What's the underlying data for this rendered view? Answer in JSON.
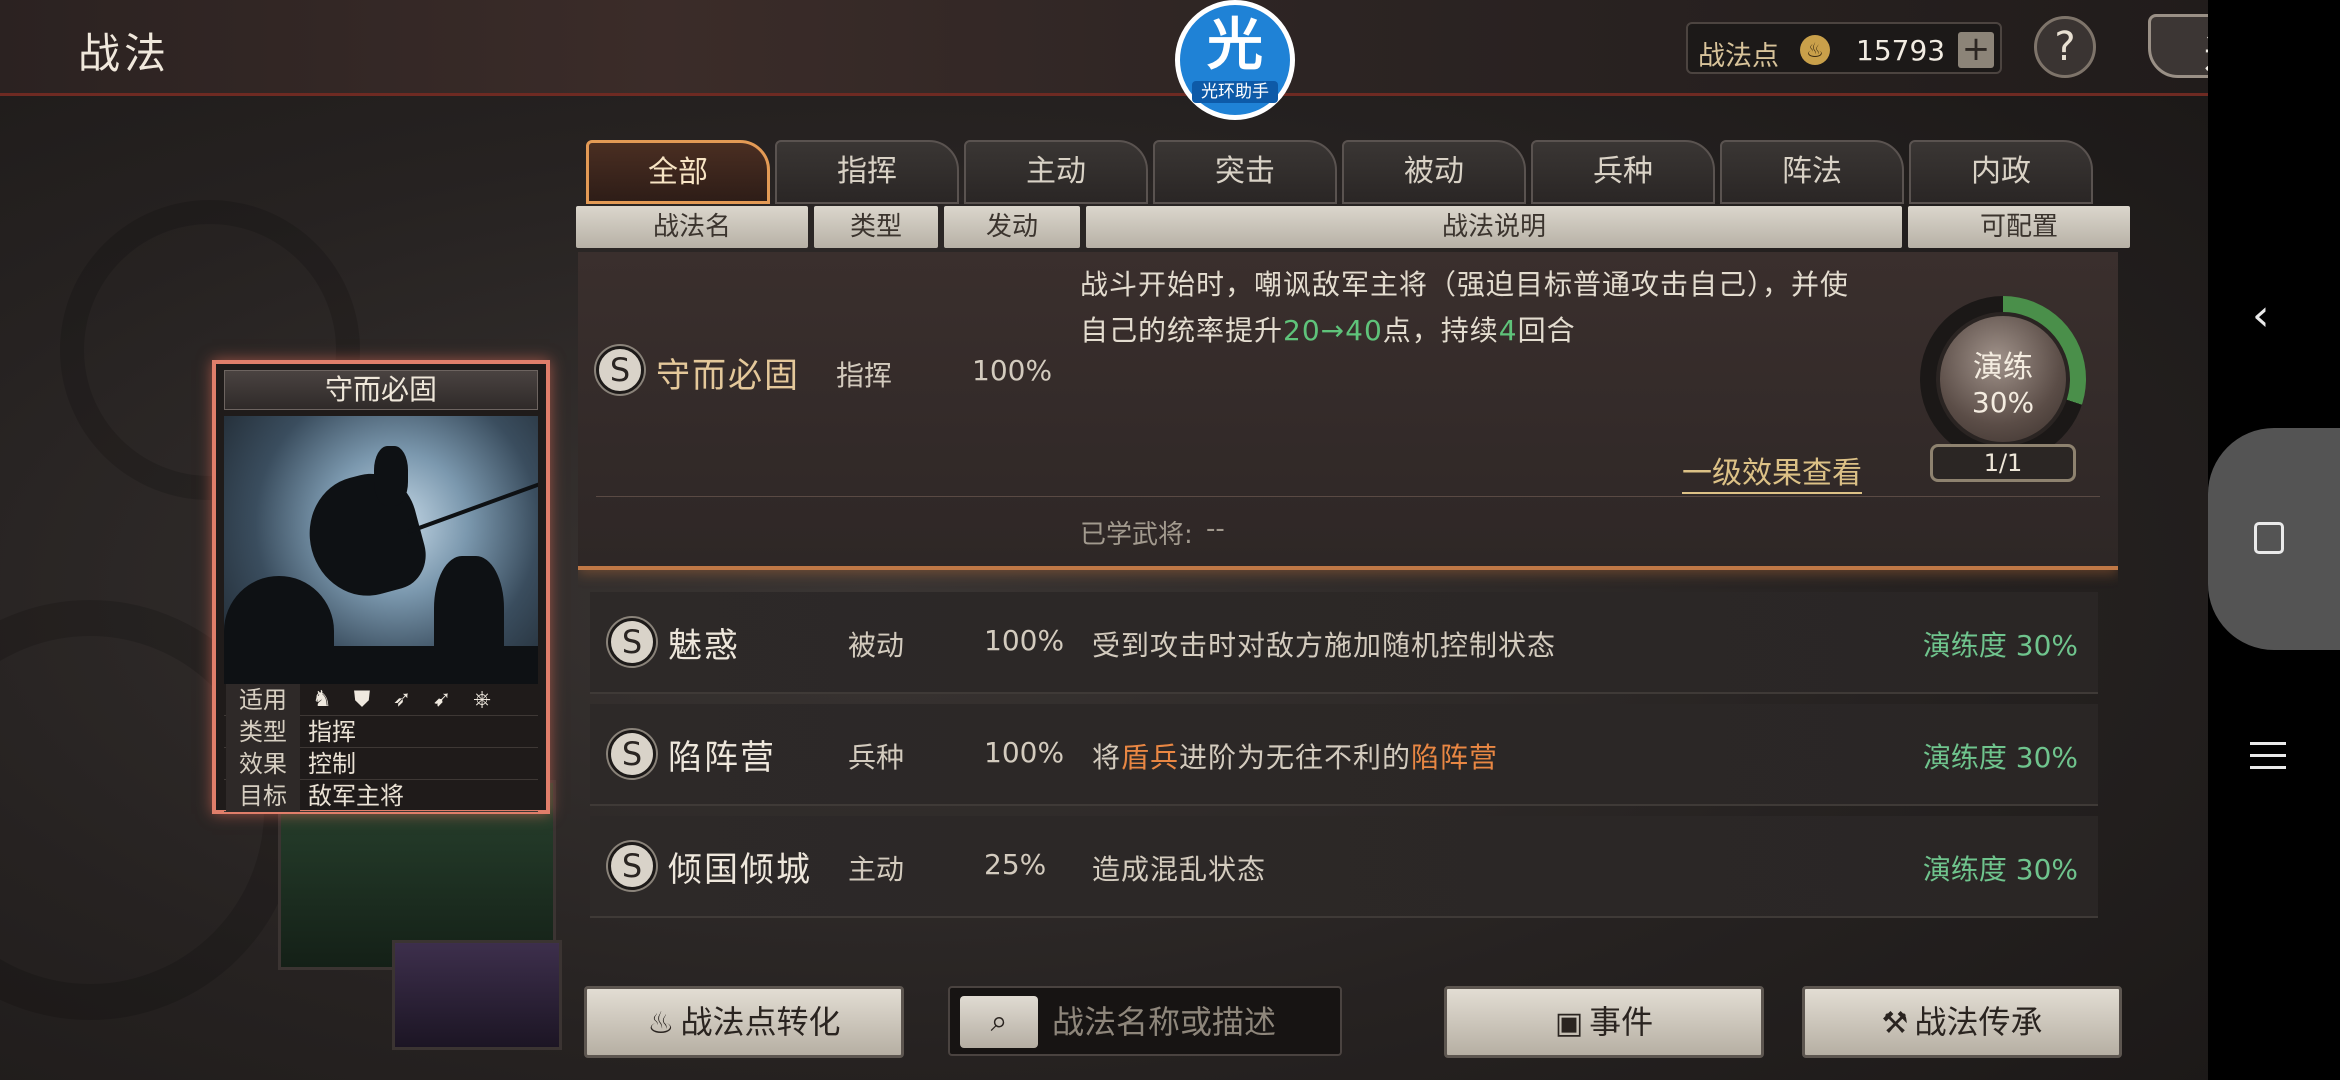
{
  "header": {
    "title": "战法",
    "logo_glyph": "光",
    "logo_text": "光环助手",
    "points_label": "战法点",
    "points_value": "15793",
    "plus": "+",
    "help": "?",
    "back": "返回"
  },
  "tabs": [
    "全部",
    "指挥",
    "主动",
    "突击",
    "被动",
    "兵种",
    "阵法",
    "内政"
  ],
  "active_tab": "全部",
  "columns": {
    "name": "战法名",
    "type": "类型",
    "trigger": "发动",
    "desc": "战法说明",
    "config": "可配置"
  },
  "expanded": {
    "grade": "S",
    "name": "守而必固",
    "type": "指挥",
    "rate": "100%",
    "desc_a": "战斗开始时，嘲讽敌军主将（强迫目标普通攻击自己），并使自己的统率提升",
    "desc_from": "20",
    "desc_arrow": "→",
    "desc_to": "40",
    "desc_b": "点，持续",
    "desc_turns": "4",
    "desc_c": "回合",
    "level_link": "一级效果查看",
    "learned_label": "已学武将:",
    "learned_value": "--",
    "drill_label": "演练",
    "drill_pct": "30%",
    "drill_progress": 0.3,
    "drill_count": "1/1"
  },
  "rows": [
    {
      "grade": "S",
      "name": "魅惑",
      "type": "被动",
      "rate": "100%",
      "desc": [
        {
          "t": "受到攻击时对敌方施加随机控制状态",
          "hl": false
        }
      ],
      "progress": "演练度 30%"
    },
    {
      "grade": "S",
      "name": "陷阵营",
      "type": "兵种",
      "rate": "100%",
      "desc": [
        {
          "t": "将",
          "hl": false
        },
        {
          "t": "盾兵",
          "hl": true
        },
        {
          "t": "进阶为无往不利的",
          "hl": false
        },
        {
          "t": "陷阵营",
          "hl": true
        }
      ],
      "progress": "演练度 30%"
    },
    {
      "grade": "S",
      "name": "倾国倾城",
      "type": "主动",
      "rate": "25%",
      "desc": [
        {
          "t": "造成混乱状态",
          "hl": false
        }
      ],
      "progress": "演练度 30%"
    }
  ],
  "card": {
    "title": "守而必固",
    "apply_label": "适用",
    "apply_icons": [
      "cavalry-icon",
      "shield-icon",
      "bow-icon",
      "spear-icon",
      "wheel-icon"
    ],
    "type_label": "类型",
    "type_value": "指挥",
    "effect_label": "效果",
    "effect_value": "控制",
    "target_label": "目标",
    "target_value": "敌军主将"
  },
  "bottom": {
    "convert": "战法点转化",
    "search_placeholder": "战法名称或描述",
    "event": "事件",
    "inherit": "战法传承"
  },
  "colors": {
    "accent": "#e39a55",
    "highlight": "#e98743",
    "green": "#6fc48d"
  }
}
